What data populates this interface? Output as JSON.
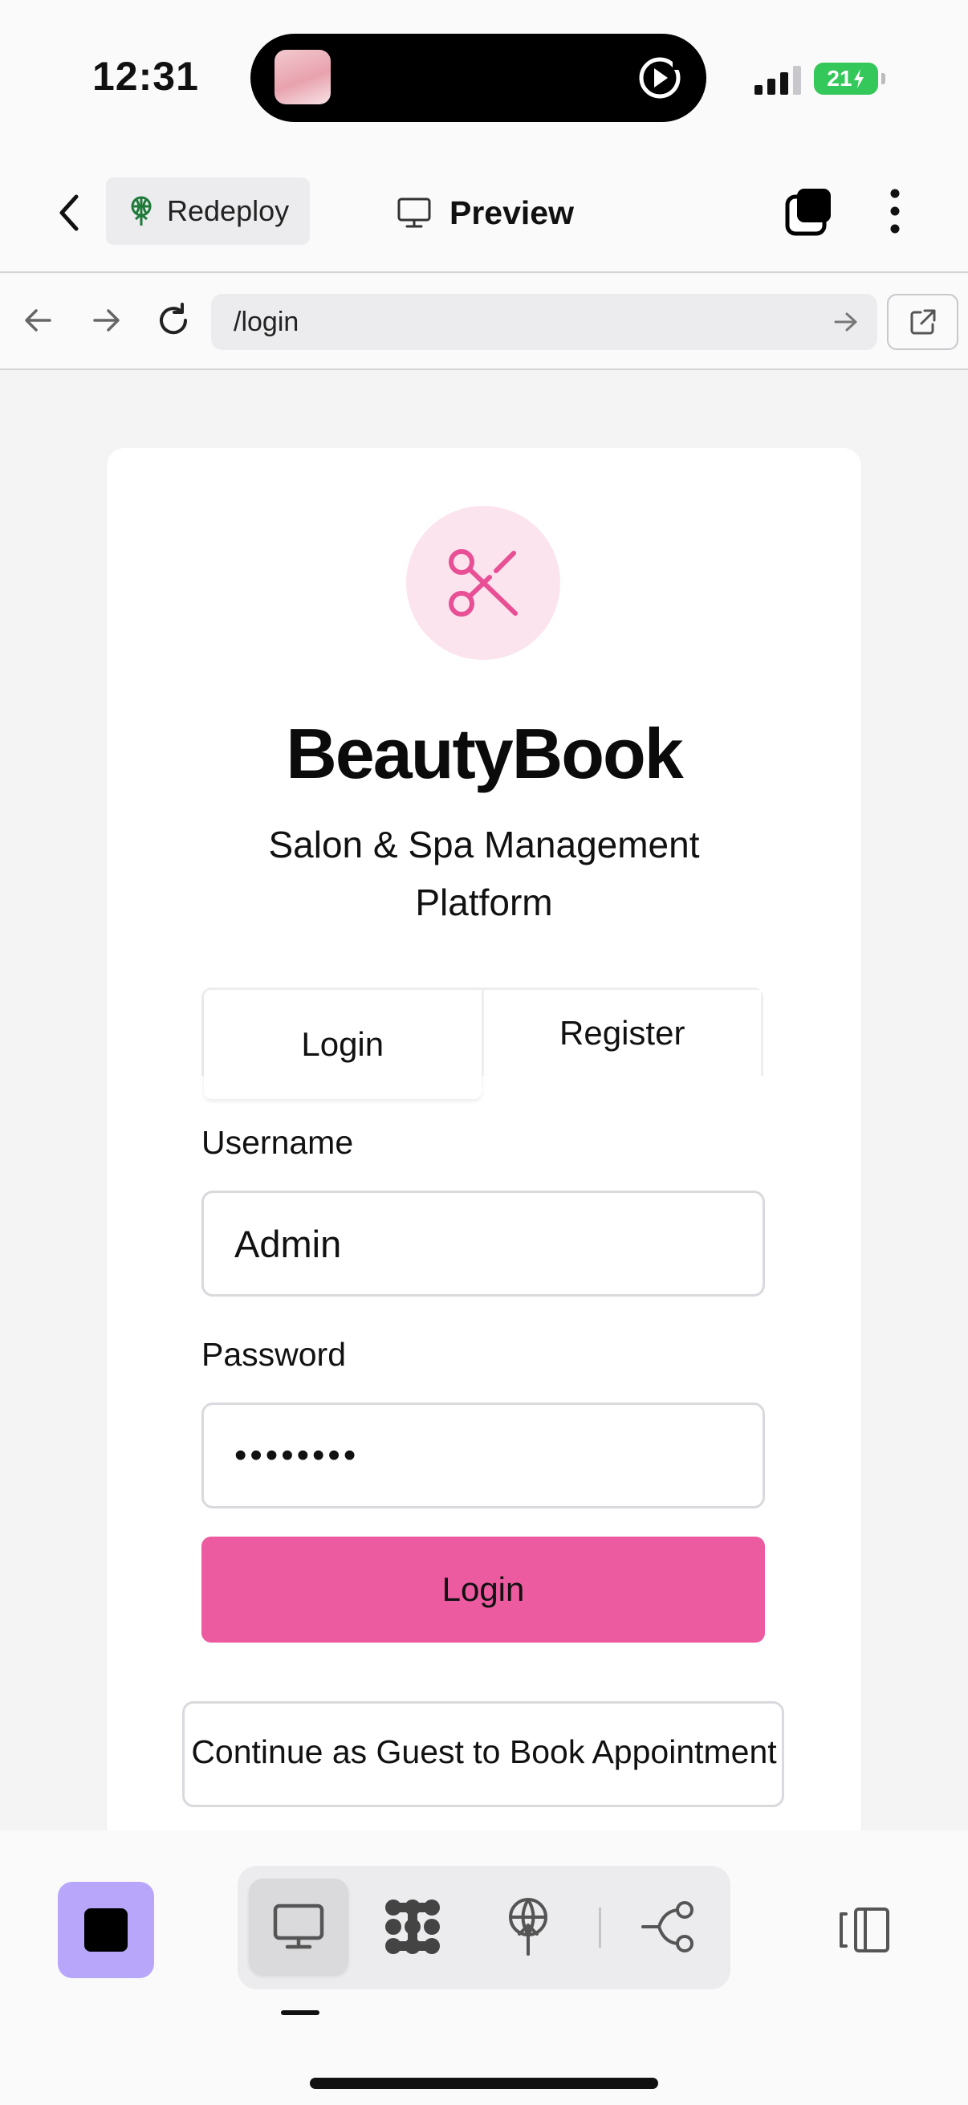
{
  "status_bar": {
    "time": "12:31",
    "battery": "21"
  },
  "app_bar": {
    "redeploy_label": "Redeploy",
    "preview_label": "Preview"
  },
  "browser": {
    "url": "/login"
  },
  "login_page": {
    "brand_title": "BeautyBook",
    "brand_subtitle": "Salon & Spa Management Platform",
    "tabs": [
      {
        "label": "Login",
        "active": true
      },
      {
        "label": "Register",
        "active": false
      }
    ],
    "username_label": "Username",
    "username_value": "Admin",
    "password_label": "Password",
    "password_value": "••••••••",
    "login_button": "Login",
    "guest_button": "Continue as Guest to Book Appointment",
    "accent_color": "#ec5a9f",
    "logo_icon": "scissors-icon"
  },
  "bottom_toolbar": {
    "tools": [
      "desktop-preview-icon",
      "nodes-icon",
      "deploy-globe-icon",
      "git-branch-icon"
    ],
    "selected_tool": "desktop-preview-icon"
  }
}
